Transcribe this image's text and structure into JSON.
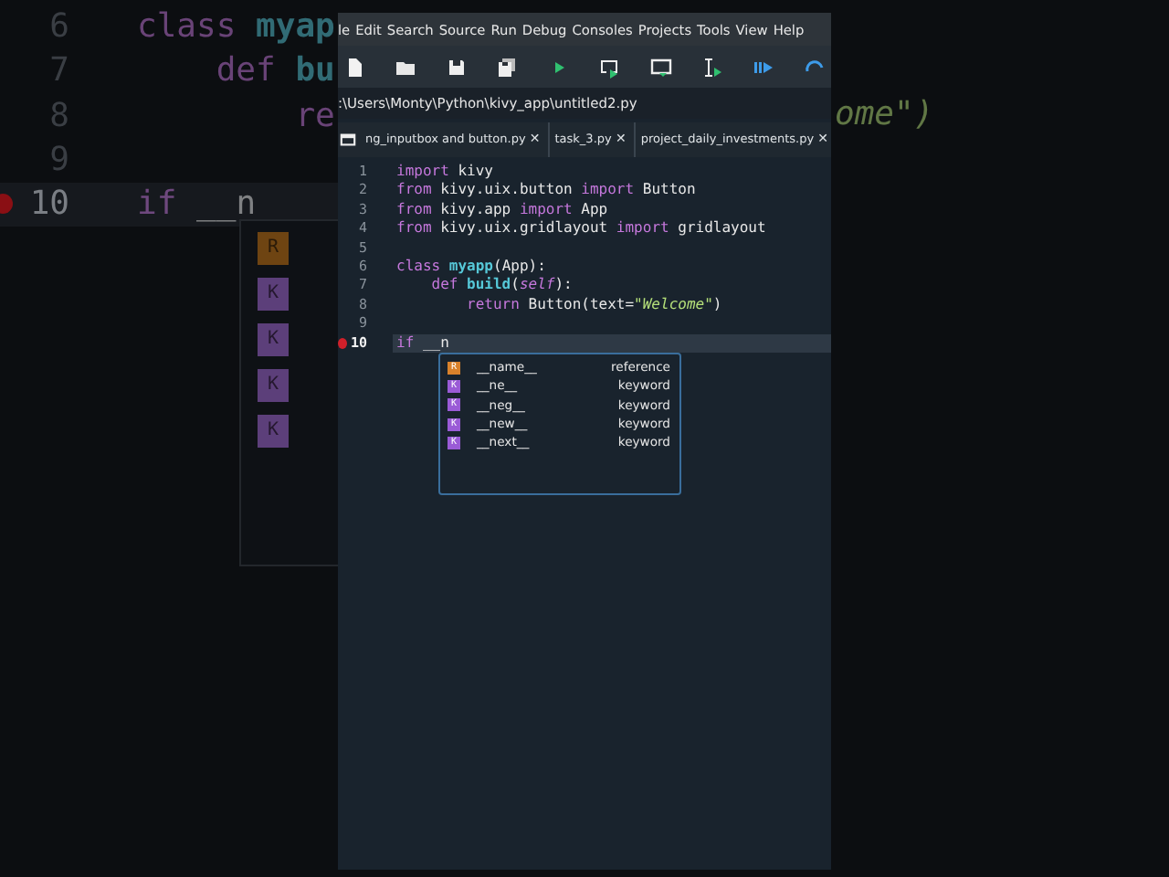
{
  "background_zoom": {
    "lines": [
      {
        "number": "6",
        "tokens": [
          {
            "text": "class ",
            "kind": "keyword"
          },
          {
            "text": "myap",
            "kind": "name"
          }
        ]
      },
      {
        "number": "7",
        "tokens": [
          {
            "text": "    def ",
            "kind": "keyword"
          },
          {
            "text": "bu",
            "kind": "name"
          }
        ]
      },
      {
        "number": "8",
        "tokens": [
          {
            "text": "        re",
            "kind": "keyword"
          }
        ]
      },
      {
        "number": "9"
      },
      {
        "number": "10",
        "tokens": [
          {
            "text": "if ",
            "kind": "keyword"
          },
          {
            "text": "__n",
            "kind": "plain"
          }
        ],
        "current": true,
        "breakpoint": true
      }
    ],
    "right_text": {
      "text": "ome\")",
      "kind": "string"
    },
    "completion_badges": [
      {
        "letter": "R",
        "kind": "reference"
      },
      {
        "letter": "K",
        "kind": "keyword"
      },
      {
        "letter": "K",
        "kind": "keyword"
      },
      {
        "letter": "K",
        "kind": "keyword"
      },
      {
        "letter": "K",
        "kind": "keyword"
      }
    ]
  },
  "menu": [
    "le",
    "Edit",
    "Search",
    "Source",
    "Run",
    "Debug",
    "Consoles",
    "Projects",
    "Tools",
    "View",
    "Help"
  ],
  "path": ":\\Users\\Monty\\Python\\kivy_app\\untitled2.py",
  "tabs": [
    {
      "label": "ng_inputbox and button.py",
      "close": "✕"
    },
    {
      "label": "task_3.py",
      "close": "✕"
    },
    {
      "label": "project_daily_investments.py",
      "close": "✕"
    }
  ],
  "editor": {
    "lines": [
      {
        "number": "1",
        "tokens": [
          {
            "text": "import ",
            "kind": "keyword"
          },
          {
            "text": "kivy",
            "kind": "plain"
          }
        ]
      },
      {
        "number": "2",
        "tokens": [
          {
            "text": "from ",
            "kind": "keyword"
          },
          {
            "text": "kivy.uix.button ",
            "kind": "plain"
          },
          {
            "text": "import ",
            "kind": "keyword"
          },
          {
            "text": "Button",
            "kind": "plain"
          }
        ]
      },
      {
        "number": "3",
        "tokens": [
          {
            "text": "from ",
            "kind": "keyword"
          },
          {
            "text": "kivy.app ",
            "kind": "plain"
          },
          {
            "text": "import ",
            "kind": "keyword"
          },
          {
            "text": "App",
            "kind": "plain"
          }
        ]
      },
      {
        "number": "4",
        "tokens": [
          {
            "text": "from ",
            "kind": "keyword"
          },
          {
            "text": "kivy.uix.gridlayout ",
            "kind": "plain"
          },
          {
            "text": "import ",
            "kind": "keyword"
          },
          {
            "text": "gridlayout",
            "kind": "plain"
          }
        ]
      },
      {
        "number": "5"
      },
      {
        "number": "6",
        "tokens": [
          {
            "text": "class ",
            "kind": "keyword"
          },
          {
            "text": "myapp",
            "kind": "name"
          },
          {
            "text": "(App):",
            "kind": "plain"
          }
        ]
      },
      {
        "number": "7",
        "tokens": [
          {
            "text": "    def ",
            "kind": "keyword"
          },
          {
            "text": "build",
            "kind": "name"
          },
          {
            "text": "(",
            "kind": "plain"
          },
          {
            "text": "self",
            "kind": "self"
          },
          {
            "text": "):",
            "kind": "plain"
          }
        ]
      },
      {
        "number": "8",
        "tokens": [
          {
            "text": "        return ",
            "kind": "keyword"
          },
          {
            "text": "Button(text=",
            "kind": "plain"
          },
          {
            "text": "\"Welcome\"",
            "kind": "string"
          },
          {
            "text": ")",
            "kind": "plain"
          }
        ]
      },
      {
        "number": "9"
      },
      {
        "number": "10",
        "tokens": [
          {
            "text": "if ",
            "kind": "keyword"
          },
          {
            "text": "__n",
            "kind": "plain"
          }
        ],
        "current": true,
        "breakpoint": true
      }
    ],
    "completions": [
      {
        "letter": "R",
        "kind": "reference",
        "name": "__name__",
        "type": "reference",
        "selected": false
      },
      {
        "letter": "K",
        "kind": "keyword",
        "name": "__ne__",
        "type": "keyword",
        "selected": false
      },
      {
        "letter": "K",
        "kind": "keyword",
        "name": "__neg__",
        "type": "keyword",
        "selected": false
      },
      {
        "letter": "K",
        "kind": "keyword",
        "name": "__new__",
        "type": "keyword",
        "selected": false
      },
      {
        "letter": "K",
        "kind": "keyword",
        "name": "__next__",
        "type": "keyword",
        "selected": false
      }
    ]
  }
}
